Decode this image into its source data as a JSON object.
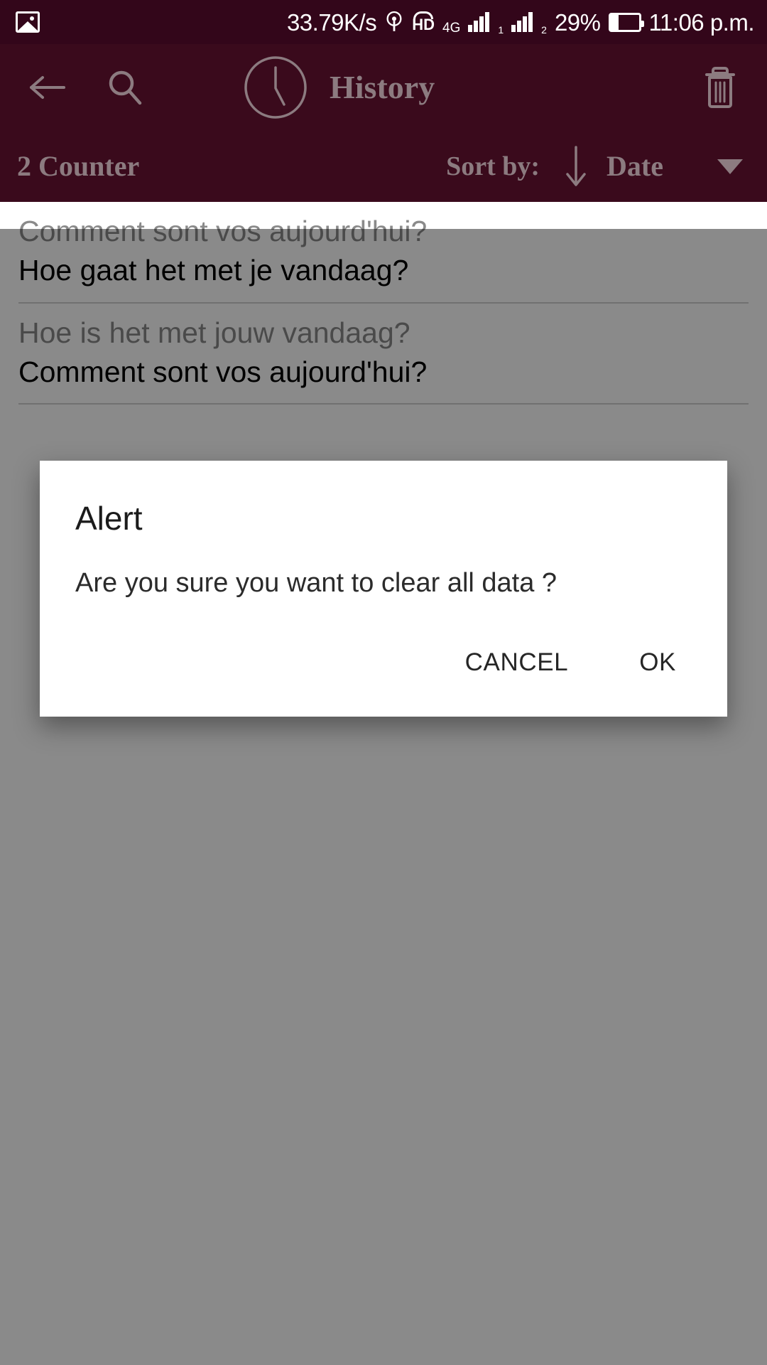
{
  "status_bar": {
    "network_speed": "33.79K/s",
    "hd_label": "HD",
    "network_type": "4G",
    "sim1_marker": "1",
    "sim2_marker": "2",
    "battery_percent": "29%",
    "clock": "11:06 p.m.",
    "icons": {
      "gallery": "photo-icon",
      "hotspot": "antenna-icon",
      "volte": "hd-call-icon",
      "signal": "signal-bars-icon",
      "battery": "battery-icon"
    }
  },
  "app_bar": {
    "title": "History",
    "back_icon": "arrow-left-icon",
    "search_icon": "search-icon",
    "clock_icon": "clock-icon",
    "delete_icon": "trash-icon"
  },
  "sort_bar": {
    "counter_label": "2 Counter",
    "sort_by_label": "Sort by:",
    "sort_direction_icon": "arrow-down-icon",
    "sort_value": "Date",
    "caret_icon": "chevron-down-icon"
  },
  "history": {
    "items": [
      {
        "source": "Comment sont vos aujourd'hui?",
        "translation": "Hoe gaat het met je vandaag?"
      },
      {
        "source": "Hoe is het met jouw vandaag?",
        "translation": "Comment sont vos aujourd'hui?"
      }
    ]
  },
  "dialog": {
    "title": "Alert",
    "message": "Are you sure you want to clear all data ?",
    "cancel_label": "CANCEL",
    "ok_label": "OK"
  },
  "colors": {
    "status_bar_bg": "#33061a",
    "app_bar_bg": "#3a0a1c",
    "app_bar_text": "#8c7b80",
    "list_bg": "#ffffff",
    "source_text": "#8a8a8a",
    "translation_text": "#000000",
    "dialog_bg": "#ffffff",
    "scrim": "rgba(0,0,0,0.46)"
  }
}
